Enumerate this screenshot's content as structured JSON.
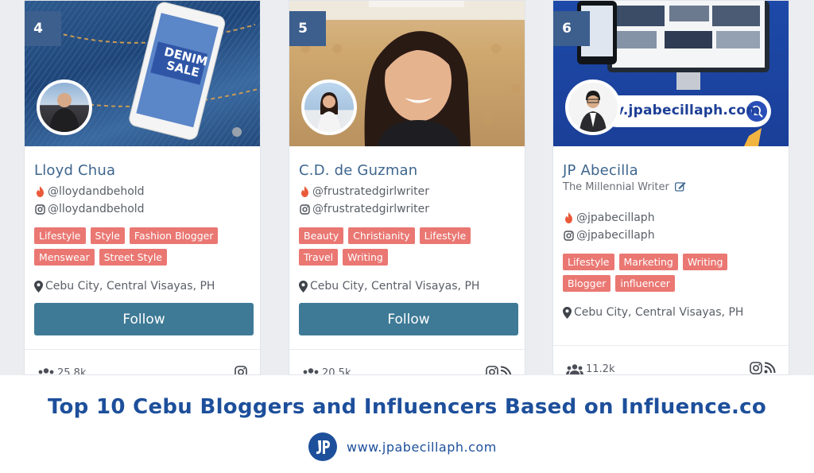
{
  "colors": {
    "accent": "#3e668e",
    "tag": "#ea7772",
    "follow": "#3e7a96",
    "headline": "#1d4f9b",
    "flame": "#ea5a3a"
  },
  "cards": [
    {
      "rank": "4",
      "name": "Lloyd Chua",
      "handle1": "@lloydandbehold",
      "handle2": "@lloydandbehold",
      "tags": [
        "Lifestyle",
        "Style",
        "Fashion Blogger",
        "Menswear",
        "Street Style"
      ],
      "location": "Cebu City, Central Visayas, PH",
      "follow_label": "Follow",
      "followers": "25.8k",
      "cover_text": {
        "brand": "DENIM",
        "line1": "DENIM",
        "line2": "SALE"
      }
    },
    {
      "rank": "5",
      "name": "C.D. de Guzman",
      "handle1": "@frustratedgirlwriter",
      "handle2": "@frustratedgirlwriter",
      "tags": [
        "Beauty",
        "Christianity",
        "Lifestyle",
        "Travel",
        "Writing"
      ],
      "location": "Cebu City, Central Visayas, PH",
      "follow_label": "Follow",
      "followers": "20.5k"
    },
    {
      "rank": "6",
      "name": "JP Abecilla",
      "tagline": "The Millennial Writer",
      "handle1": "@jpabecillaph",
      "handle2": "@jpabecillaph",
      "tags": [
        "Lifestyle",
        "Marketing",
        "Writing",
        "Blogger",
        "influencer"
      ],
      "location": "Cebu City, Central Visayas, PH",
      "followers": "11.2k",
      "cover_text": {
        "site": "v.jpabecillaph.com"
      }
    }
  ],
  "footer": {
    "headline": "Top 10 Cebu Bloggers and Influencers Based on Influence.co",
    "site_url": "www.jpabecillaph.com"
  }
}
